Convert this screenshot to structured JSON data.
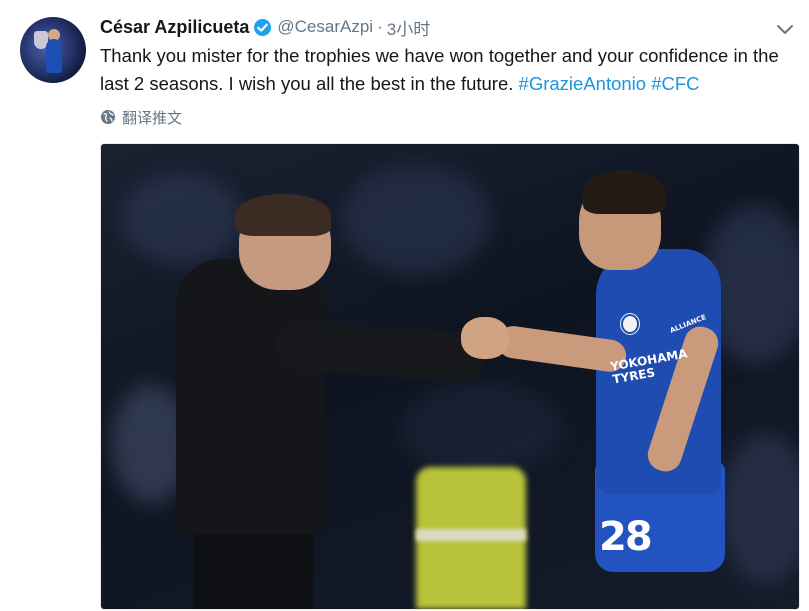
{
  "tweet": {
    "author_name": "César Azpilicueta",
    "handle": "@CesarAzpi",
    "separator": "·",
    "time": "3小时",
    "text_plain": "Thank you mister for the trophies we have won together and your confidence in the last 2 seasons. I wish you all the best in the future. ",
    "hashtags": [
      "#GrazieAntonio",
      "#CFC"
    ],
    "translate_label": "翻译推文",
    "photo": {
      "shirt_number": "28",
      "sponsor_line1": "YOKOHAMA",
      "sponsor_line2": "TYRES",
      "alliance_text": "ALLIANCE"
    }
  },
  "colors": {
    "verified_badge": "#1da1f2",
    "hashtag": "#1b95e0",
    "secondary_text": "#657786"
  },
  "icons": {
    "verified": "verified-badge-icon",
    "caret": "chevron-down-icon",
    "translate": "globe-icon"
  }
}
